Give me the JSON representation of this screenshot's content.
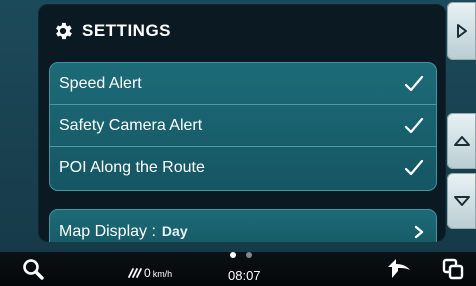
{
  "header": {
    "title": "SETTINGS",
    "icon": "gear-icon"
  },
  "settings": {
    "toggles": [
      {
        "label": "Speed Alert",
        "checked": true
      },
      {
        "label": "Safety Camera Alert",
        "checked": true
      },
      {
        "label": "POI Along the Route",
        "checked": true
      }
    ],
    "map_display": {
      "label": "Map Display :",
      "value": "Day"
    }
  },
  "status_bar": {
    "speed_value": "0",
    "speed_unit": "km/h",
    "time": "08:07",
    "page_index": 1,
    "page_count": 2
  },
  "colors": {
    "row_background": "#1a6270",
    "row_border": "#3f95a2",
    "panel_background": "#0b1a22",
    "side_button": "#dfeaed"
  }
}
